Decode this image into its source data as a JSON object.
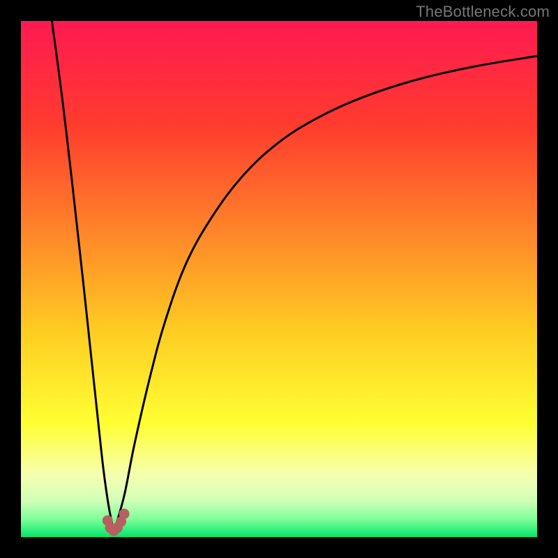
{
  "watermark": "TheBottleneck.com",
  "colors": {
    "frame": "#000000",
    "gradient_stops": [
      {
        "offset": 0.0,
        "color": "#ff1a51"
      },
      {
        "offset": 0.2,
        "color": "#ff3b2e"
      },
      {
        "offset": 0.4,
        "color": "#ff822a"
      },
      {
        "offset": 0.6,
        "color": "#ffcc22"
      },
      {
        "offset": 0.78,
        "color": "#ffff33"
      },
      {
        "offset": 0.88,
        "color": "#f6ffb0"
      },
      {
        "offset": 0.93,
        "color": "#d0ffb8"
      },
      {
        "offset": 0.965,
        "color": "#7fff9a"
      },
      {
        "offset": 1.0,
        "color": "#00e66a"
      }
    ],
    "curve": "#000000",
    "marker_fill": "#b85f5f",
    "marker_stroke": "#8f4040"
  },
  "chart_data": {
    "type": "line",
    "title": "",
    "xlabel": "",
    "ylabel": "",
    "xlim": [
      0,
      100
    ],
    "ylim": [
      0,
      100
    ],
    "x_optimum": 18,
    "series": [
      {
        "name": "curve-left",
        "x": [
          6.0,
          8.0,
          10.0,
          12.0,
          13.5,
          15.0,
          16.0,
          17.0,
          18.0
        ],
        "y": [
          100,
          85.0,
          68.0,
          50.0,
          36.0,
          22.0,
          13.0,
          6.0,
          1.0
        ]
      },
      {
        "name": "curve-right",
        "x": [
          18.0,
          20.0,
          22.0,
          25.0,
          28.0,
          32.0,
          37.0,
          43.0,
          50.0,
          58.0,
          67.0,
          77.0,
          88.0,
          100.0
        ],
        "y": [
          1.0,
          8.0,
          18.0,
          31.0,
          42.0,
          53.0,
          62.0,
          70.0,
          76.5,
          81.5,
          85.5,
          88.7,
          91.2,
          93.2
        ]
      }
    ],
    "markers": [
      {
        "x": 16.8,
        "y": 3.2
      },
      {
        "x": 17.3,
        "y": 1.8
      },
      {
        "x": 18.0,
        "y": 1.2
      },
      {
        "x": 18.7,
        "y": 1.8
      },
      {
        "x": 19.4,
        "y": 3.0
      },
      {
        "x": 20.0,
        "y": 4.5
      }
    ]
  }
}
